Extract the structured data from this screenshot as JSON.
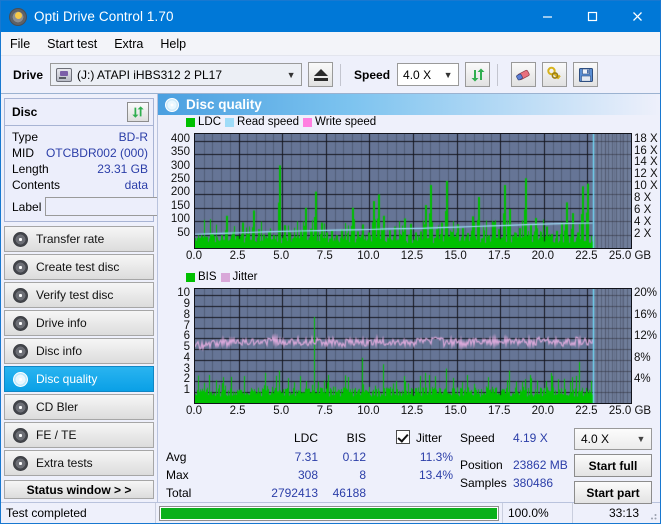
{
  "window": {
    "title": "Opti Drive Control 1.70",
    "icon": "disc-icon",
    "minimize": "minimize-icon",
    "maximize": "maximize-icon",
    "close": "close-icon"
  },
  "menu": {
    "items": [
      "File",
      "Start test",
      "Extra",
      "Help"
    ]
  },
  "toolbar": {
    "drive_label": "Drive",
    "drive_value": "(J:)   ATAPI iHBS312   2 PL17",
    "eject_title": "eject-icon",
    "speed_label": "Speed",
    "speed_value": "4.0 X",
    "refresh_icon": "refresh-icon",
    "erase_icon": "eraser-icon",
    "keys_icon": "keys-icon",
    "save_icon": "floppy-save-icon"
  },
  "disc": {
    "title": "Disc",
    "refresh_icon": "refresh-icon",
    "rows": [
      {
        "key": "Type",
        "value": "BD-R"
      },
      {
        "key": "MID",
        "value": "OTCBDR002 (000)"
      },
      {
        "key": "Length",
        "value": "23.31 GB"
      },
      {
        "key": "Contents",
        "value": "data"
      }
    ],
    "label_key": "Label",
    "label_value": "",
    "label_placeholder": "",
    "label_button_icon": "disc-icon"
  },
  "nav": {
    "items": [
      {
        "label": "Transfer rate",
        "selected": false
      },
      {
        "label": "Create test disc",
        "selected": false
      },
      {
        "label": "Verify test disc",
        "selected": false
      },
      {
        "label": "Drive info",
        "selected": false
      },
      {
        "label": "Disc info",
        "selected": false
      },
      {
        "label": "Disc quality",
        "selected": true
      },
      {
        "label": "CD Bler",
        "selected": false
      },
      {
        "label": "FE / TE",
        "selected": false
      },
      {
        "label": "Extra tests",
        "selected": false
      }
    ],
    "status_window": "Status window > >"
  },
  "panel": {
    "title": "Disc quality",
    "icon": "disc-quality-icon"
  },
  "stats": {
    "col_ldc": "LDC",
    "col_bis": "BIS",
    "jitter_label": "Jitter",
    "jitter_checked": true,
    "rows": [
      {
        "name": "Avg",
        "ldc": "7.31",
        "bis": "0.12",
        "jitter": "11.3%"
      },
      {
        "name": "Max",
        "ldc": "308",
        "bis": "8",
        "jitter": "13.4%"
      },
      {
        "name": "Total",
        "ldc": "2792413",
        "bis": "46188",
        "jitter": ""
      }
    ],
    "speed_label": "Speed",
    "speed_value": "4.19 X",
    "position_label": "Position",
    "position_value": "23862 MB",
    "samples_label": "Samples",
    "samples_value": "380486",
    "speed_select": "4.0 X",
    "start_full": "Start full",
    "start_part": "Start part"
  },
  "statusbar": {
    "message": "Test completed",
    "percent_label": "100.0%",
    "percent_value": 100,
    "time": "33:13",
    "progress_color": "#0ab01a"
  },
  "colors": {
    "accent": "#0078d7",
    "plot_bg": "#667596",
    "ldc": "#00c000",
    "bis": "#00c000",
    "read_speed": "#9fdcf8",
    "write_speed": "#ff7fe0",
    "jitter": "#d9a8d9",
    "value_text": "#2b3ea8"
  },
  "chart_data": [
    {
      "type": "bar",
      "title": "Disc quality - LDC",
      "xlabel": "GB",
      "ylabel": "LDC",
      "xlim": [
        0,
        25
      ],
      "ylim": [
        0,
        425
      ],
      "y2lim": [
        0,
        19.1
      ],
      "y2label": "X",
      "grid": true,
      "legend_position": "top-left",
      "legend": [
        "LDC",
        "Read speed",
        "Write speed"
      ],
      "xticks": [
        "0.0",
        "2.5",
        "5.0",
        "7.5",
        "10.0",
        "12.5",
        "15.0",
        "17.5",
        "20.0",
        "22.5",
        "25.0"
      ],
      "yticks": [
        400,
        350,
        300,
        250,
        200,
        150,
        100,
        50
      ],
      "y2ticks": [
        "18 X",
        "16 X",
        "14 X",
        "12 X",
        "10 X",
        "8 X",
        "6 X",
        "4 X",
        "2 X"
      ],
      "series": [
        {
          "name": "LDC",
          "color": "#00c000",
          "render": "bars",
          "note": "dense green spikes, baseline ~25-45, scattered peaks",
          "x": [
            0.1,
            0.35,
            0.6,
            0.9,
            1.2,
            1.5,
            1.8,
            2.1,
            2.4,
            2.7,
            3.0,
            3.3,
            3.6,
            3.9,
            4.2,
            4.5,
            4.8,
            5.1,
            5.4,
            5.7,
            6.0,
            6.3,
            6.6,
            6.9,
            7.2,
            7.5,
            7.8,
            8.1,
            8.4,
            8.7,
            9.0,
            9.3,
            9.6,
            9.9,
            10.2,
            10.5,
            10.8,
            11.1,
            11.4,
            11.7,
            12.0,
            12.3,
            12.6,
            12.9,
            13.2,
            13.5,
            13.8,
            14.1,
            14.4,
            14.7,
            15.0,
            15.3,
            15.6,
            15.9,
            16.2,
            16.5,
            16.8,
            17.1,
            17.4,
            17.7,
            18.0,
            18.3,
            18.6,
            18.9,
            19.2,
            19.5,
            19.8,
            20.1,
            20.4,
            20.7,
            21.0,
            21.3,
            21.6,
            21.9,
            22.2,
            22.5,
            22.8
          ],
          "values": [
            35,
            30,
            42,
            55,
            38,
            48,
            120,
            60,
            45,
            95,
            52,
            140,
            70,
            50,
            62,
            48,
            308,
            85,
            58,
            44,
            66,
            150,
            72,
            210,
            95,
            58,
            64,
            48,
            70,
            55,
            150,
            62,
            88,
            58,
            175,
            200,
            120,
            66,
            80,
            52,
            110,
            90,
            58,
            62,
            160,
            235,
            70,
            95,
            250,
            60,
            88,
            74,
            56,
            118,
            190,
            66,
            48,
            96,
            70,
            235,
            145,
            58,
            74,
            260,
            90,
            112,
            60,
            80,
            52,
            64,
            95,
            170,
            130,
            58,
            230,
            240,
            44
          ]
        },
        {
          "name": "Read speed",
          "color": "#9fdcf8",
          "render": "line",
          "note": "stepped read speed curve rising 2.3X to 4.2X",
          "x": [
            0.0,
            1.0,
            2.0,
            3.0,
            4.0,
            5.0,
            6.0,
            7.0,
            8.0,
            9.0,
            10.0,
            11.0,
            12.0,
            13.0,
            14.0,
            15.0,
            16.0,
            17.0,
            18.0,
            19.0,
            20.0,
            21.0,
            22.0,
            22.8
          ],
          "values": [
            2.3,
            2.4,
            2.5,
            2.6,
            2.7,
            2.8,
            2.85,
            2.9,
            3.0,
            3.05,
            3.1,
            3.2,
            3.25,
            3.3,
            3.4,
            3.5,
            3.6,
            3.7,
            3.8,
            3.9,
            4.0,
            4.1,
            4.15,
            4.19
          ]
        },
        {
          "name": "Write speed",
          "color": "#ff7fe0",
          "render": "line",
          "note": "not present in this test",
          "x": [],
          "values": []
        }
      ],
      "markers": [
        {
          "type": "vline",
          "x": 22.8,
          "color": "#6fd8f5"
        }
      ]
    },
    {
      "type": "bar",
      "title": "Disc quality - BIS",
      "xlabel": "GB",
      "ylabel": "BIS",
      "xlim": [
        0,
        25
      ],
      "ylim": [
        0,
        10.6
      ],
      "y2lim": [
        0,
        21.2
      ],
      "y2label": "%",
      "grid": true,
      "legend_position": "top-left",
      "legend": [
        "BIS",
        "Jitter"
      ],
      "xticks": [
        "0.0",
        "2.5",
        "5.0",
        "7.5",
        "10.0",
        "12.5",
        "15.0",
        "17.5",
        "20.0",
        "22.5",
        "25.0"
      ],
      "yticks": [
        10,
        9,
        8,
        7,
        6,
        5,
        4,
        3,
        2,
        1
      ],
      "y2ticks": [
        "20%",
        "16%",
        "12%",
        "8%",
        "4%"
      ],
      "series": [
        {
          "name": "BIS",
          "color": "#00c000",
          "render": "bars",
          "note": "dense green baseline ~1.0-1.4 with scattered spikes up to 8",
          "x": [
            0.1,
            0.4,
            0.8,
            1.2,
            1.6,
            2.0,
            2.4,
            2.8,
            3.2,
            3.6,
            4.0,
            4.4,
            4.8,
            5.2,
            5.6,
            6.0,
            6.4,
            6.8,
            7.2,
            7.6,
            8.0,
            8.4,
            8.8,
            9.2,
            9.6,
            10.0,
            10.4,
            10.8,
            11.2,
            11.6,
            12.0,
            12.4,
            12.8,
            13.2,
            13.6,
            14.0,
            14.4,
            14.8,
            15.2,
            15.6,
            16.0,
            16.4,
            16.8,
            17.2,
            17.6,
            18.0,
            18.4,
            18.8,
            19.2,
            19.6,
            20.0,
            20.4,
            20.8,
            21.2,
            21.6,
            22.0,
            22.4,
            22.8
          ],
          "values": [
            1.2,
            1.3,
            2.6,
            1.4,
            2.4,
            1.3,
            1.2,
            2.5,
            1.4,
            1.3,
            2.8,
            1.5,
            3.0,
            1.3,
            1.4,
            2.5,
            1.3,
            8.0,
            1.4,
            2.6,
            1.5,
            1.3,
            2.4,
            1.4,
            4.2,
            1.5,
            1.3,
            3.6,
            1.4,
            1.3,
            2.5,
            1.4,
            1.3,
            2.8,
            1.5,
            1.4,
            3.2,
            1.3,
            1.4,
            2.6,
            1.5,
            1.3,
            2.4,
            1.4,
            1.3,
            3.0,
            1.4,
            1.5,
            2.6,
            1.3,
            1.4,
            2.8,
            1.5,
            1.3,
            2.4,
            3.8,
            1.4,
            1.3
          ]
        },
        {
          "name": "Jitter",
          "color": "#d9a8d9",
          "render": "line",
          "note": "noisy band oscillating around 11.3%, max 13.4%",
          "x": [
            0.0,
            0.5,
            1.0,
            1.5,
            2.0,
            2.5,
            3.0,
            3.5,
            4.0,
            4.5,
            5.0,
            5.5,
            6.0,
            6.5,
            7.0,
            7.5,
            8.0,
            8.5,
            9.0,
            9.5,
            10.0,
            10.5,
            11.0,
            11.5,
            12.0,
            12.5,
            13.0,
            13.5,
            14.0,
            14.5,
            15.0,
            15.5,
            16.0,
            16.5,
            17.0,
            17.5,
            18.0,
            18.5,
            19.0,
            19.5,
            20.0,
            20.5,
            21.0,
            21.5,
            22.0,
            22.5,
            22.8
          ],
          "values": [
            10.8,
            10.6,
            11.0,
            11.4,
            11.2,
            11.6,
            11.3,
            11.5,
            11.2,
            11.7,
            11.4,
            11.1,
            11.5,
            11.3,
            11.6,
            11.2,
            11.4,
            11.0,
            11.3,
            11.5,
            11.2,
            11.6,
            11.3,
            11.1,
            11.4,
            11.2,
            11.5,
            11.3,
            11.6,
            11.2,
            11.4,
            11.1,
            11.5,
            11.3,
            11.2,
            11.6,
            11.4,
            11.3,
            11.5,
            11.2,
            11.6,
            11.3,
            11.4,
            11.2,
            11.5,
            11.3,
            11.2
          ]
        }
      ],
      "markers": [
        {
          "type": "vline",
          "x": 22.8,
          "color": "#6fd8f5"
        }
      ]
    }
  ]
}
